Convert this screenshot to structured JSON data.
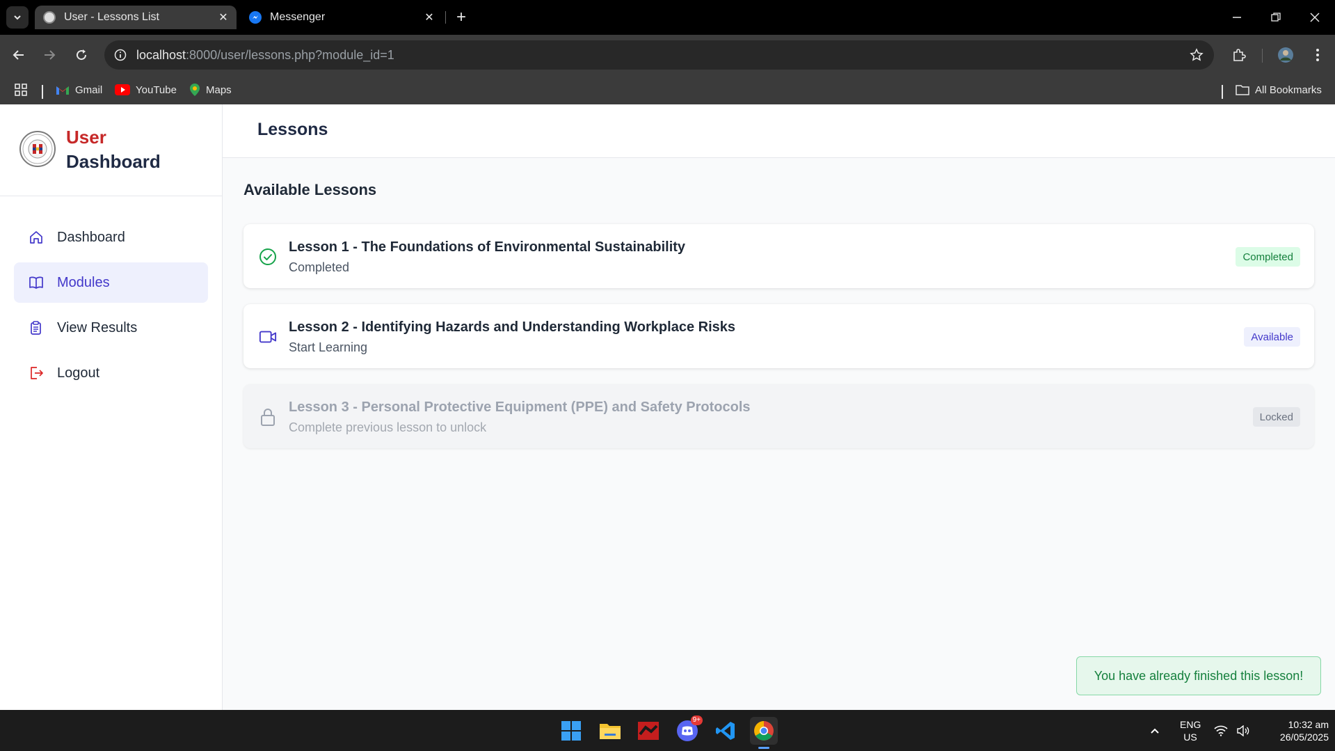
{
  "browser": {
    "tabs": [
      {
        "title": "User - Lessons List",
        "active": true
      },
      {
        "title": "Messenger",
        "active": false
      }
    ],
    "url_host": "localhost",
    "url_rest": ":8000/user/lessons.php?module_id=1",
    "bookmarks": [
      "Gmail",
      "YouTube",
      "Maps"
    ],
    "all_bookmarks": "All Bookmarks"
  },
  "sidebar": {
    "brand_line1": "User",
    "brand_line2": "Dashboard",
    "items": [
      {
        "label": "Dashboard",
        "icon": "home-icon",
        "active": false
      },
      {
        "label": "Modules",
        "icon": "book-icon",
        "active": true
      },
      {
        "label": "View Results",
        "icon": "clipboard-icon",
        "active": false
      },
      {
        "label": "Logout",
        "icon": "logout-icon",
        "active": false
      }
    ]
  },
  "page": {
    "title": "Lessons",
    "section_title": "Available Lessons"
  },
  "lessons": [
    {
      "title": "Lesson 1 - The Foundations of Environmental Sustainability",
      "subtitle": "Completed",
      "badge": "Completed",
      "status": "completed",
      "icon": "check-circle-icon"
    },
    {
      "title": "Lesson 2 - Identifying Hazards and Understanding Workplace Risks",
      "subtitle": "Start Learning",
      "badge": "Available",
      "status": "available",
      "icon": "video-icon"
    },
    {
      "title": "Lesson 3 - Personal Protective Equipment (PPE) and Safety Protocols",
      "subtitle": "Complete previous lesson to unlock",
      "badge": "Locked",
      "status": "locked",
      "icon": "lock-icon"
    }
  ],
  "toast": "You have already finished this lesson!",
  "taskbar": {
    "lang_line1": "ENG",
    "lang_line2": "US",
    "time": "10:32 am",
    "date": "26/05/2025",
    "discord_badge": "9+"
  },
  "colors": {
    "completed_bg": "#dcfce7",
    "completed_fg": "#15803d",
    "available_bg": "#eef0fd",
    "available_fg": "#4338ca",
    "locked_bg": "#e5e7eb",
    "locked_fg": "#6b7280",
    "brand_red": "#c62828",
    "accent": "#4338ca"
  }
}
